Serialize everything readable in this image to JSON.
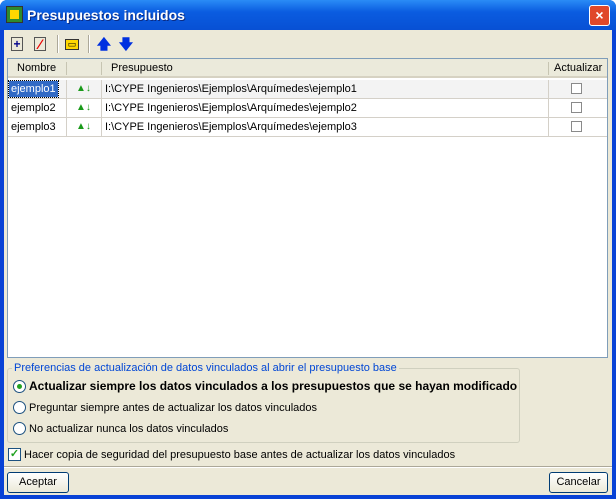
{
  "window": {
    "title": "Presupuestos incluidos",
    "close_icon": "×"
  },
  "toolbar": {
    "icons": {
      "new": "+",
      "delete": "⁄",
      "edit": "▭",
      "up": "🡅",
      "down": "🡇"
    }
  },
  "table": {
    "columns": [
      "Nombre",
      "",
      "Presupuesto",
      "Actualizar"
    ],
    "rows": [
      {
        "nombre": "ejemplo1",
        "icon": "▲↓",
        "path": "I:\\CYPE Ingenieros\\Ejemplos\\Arquímedes\\ejemplo1",
        "actualizar": false
      },
      {
        "nombre": "ejemplo2",
        "icon": "▲↓",
        "path": "I:\\CYPE Ingenieros\\Ejemplos\\Arquímedes\\ejemplo2",
        "actualizar": false
      },
      {
        "nombre": "ejemplo3",
        "icon": "▲↓",
        "path": "I:\\CYPE Ingenieros\\Ejemplos\\Arquímedes\\ejemplo3",
        "actualizar": false
      }
    ]
  },
  "prefs": {
    "legend": "Preferencias de actualización de datos vinculados al abrir el presupuesto base",
    "options": [
      "Actualizar siempre los datos vinculados a los presupuestos que se hayan modificado",
      "Preguntar siempre antes de actualizar los datos vinculados",
      "No actualizar nunca los datos vinculados"
    ],
    "selected": 0
  },
  "backup": {
    "label": "Hacer copia de seguridad del presupuesto base antes de actualizar los datos vinculados",
    "checked": true,
    "mark": "✓"
  },
  "buttons": {
    "ok": "Aceptar",
    "cancel": "Cancelar"
  }
}
